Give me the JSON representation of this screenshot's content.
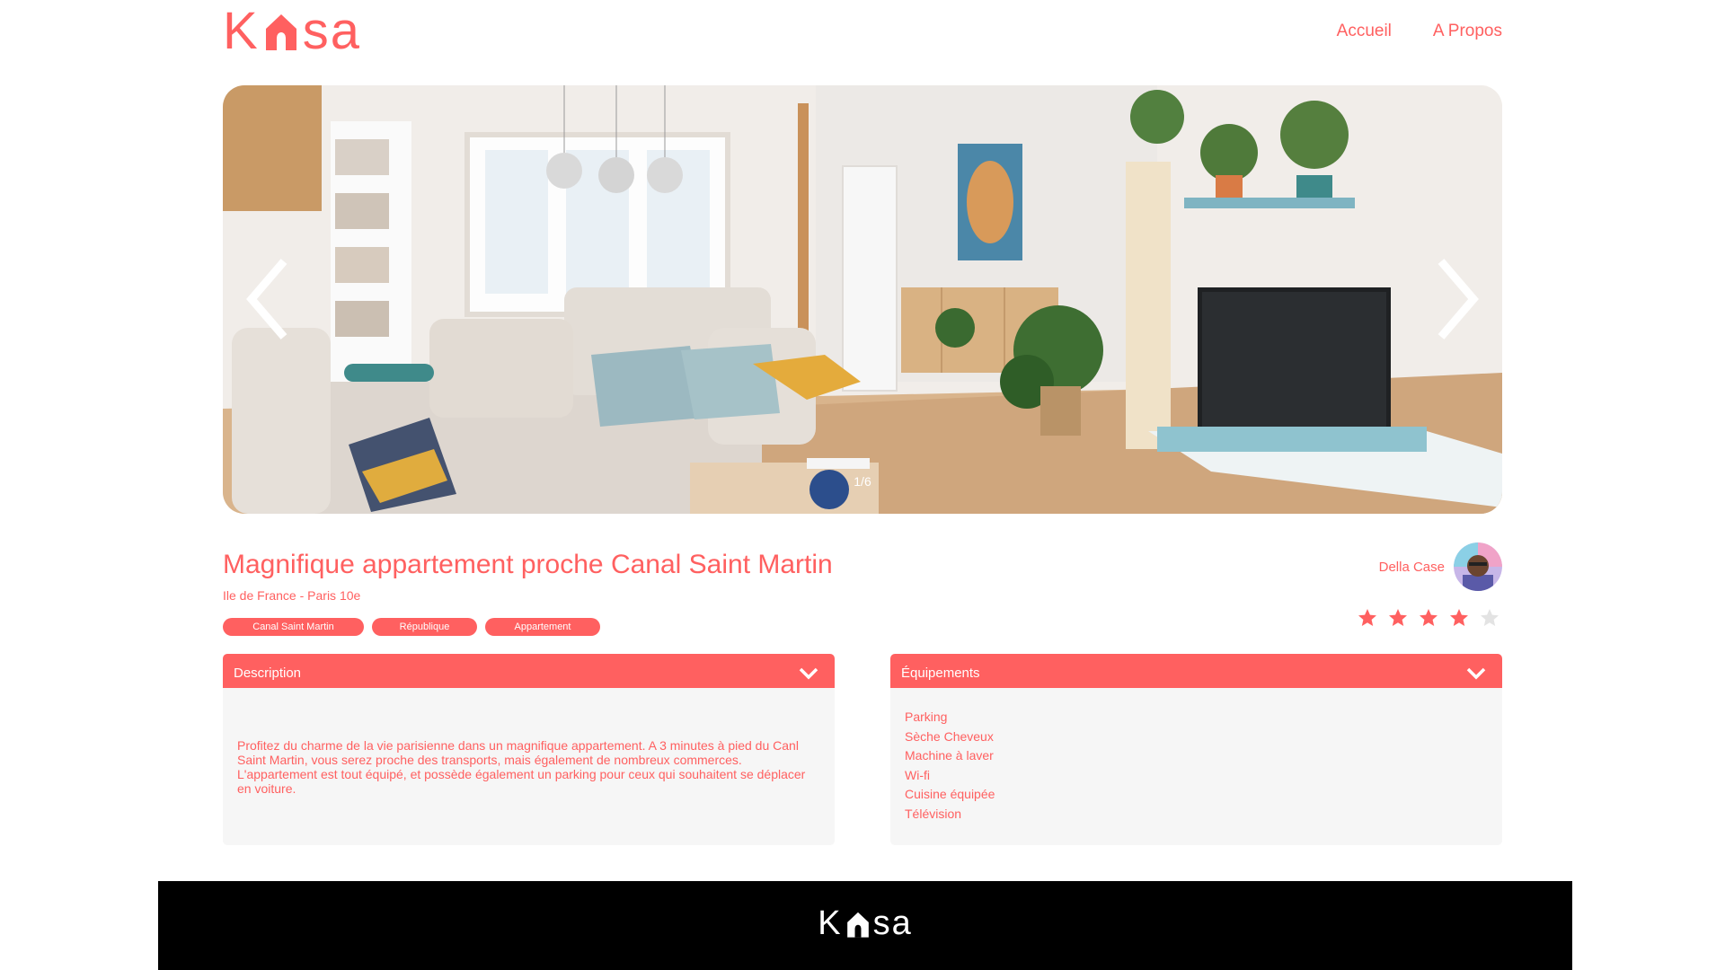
{
  "brand": {
    "logo_text_start": "K",
    "logo_text_end": "sa",
    "accent_color": "#FF6060"
  },
  "nav": {
    "items": [
      {
        "label": "Accueil"
      },
      {
        "label": "A Propos"
      }
    ]
  },
  "carousel": {
    "counter": "1/6",
    "prev_icon": "chevron-left-icon",
    "next_icon": "chevron-right-icon"
  },
  "listing": {
    "title": "Magnifique appartement proche Canal Saint Martin",
    "location": "Ile de France - Paris 10e",
    "tags": [
      "Canal Saint Martin",
      "République",
      "Appartement"
    ],
    "host_name": "Della Case",
    "rating": 4,
    "rating_max": 5
  },
  "description": {
    "title": "Description",
    "text": "Profitez du charme de la vie parisienne dans un magnifique appartement. A 3 minutes à pied du Canl Saint Martin, vous serez proche des transports, mais également de nombreux commerces. L'appartement est tout équipé, et possède également un parking pour ceux qui souhaitent se déplacer en voiture."
  },
  "equipments": {
    "title": "Équipements",
    "items": [
      "Parking",
      "Sèche Cheveux",
      "Machine à laver",
      "Wi-fi",
      "Cuisine équipée",
      "Télévision"
    ]
  },
  "footer": {
    "logo_text_start": "K",
    "logo_text_end": "sa"
  }
}
